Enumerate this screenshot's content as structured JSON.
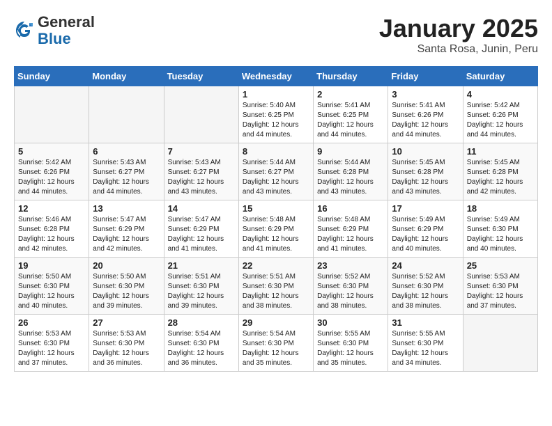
{
  "header": {
    "logo_line1": "General",
    "logo_line2": "Blue",
    "title": "January 2025",
    "subtitle": "Santa Rosa, Junin, Peru"
  },
  "weekdays": [
    "Sunday",
    "Monday",
    "Tuesday",
    "Wednesday",
    "Thursday",
    "Friday",
    "Saturday"
  ],
  "weeks": [
    [
      {
        "day": "",
        "info": ""
      },
      {
        "day": "",
        "info": ""
      },
      {
        "day": "",
        "info": ""
      },
      {
        "day": "1",
        "info": "Sunrise: 5:40 AM\nSunset: 6:25 PM\nDaylight: 12 hours\nand 44 minutes."
      },
      {
        "day": "2",
        "info": "Sunrise: 5:41 AM\nSunset: 6:25 PM\nDaylight: 12 hours\nand 44 minutes."
      },
      {
        "day": "3",
        "info": "Sunrise: 5:41 AM\nSunset: 6:26 PM\nDaylight: 12 hours\nand 44 minutes."
      },
      {
        "day": "4",
        "info": "Sunrise: 5:42 AM\nSunset: 6:26 PM\nDaylight: 12 hours\nand 44 minutes."
      }
    ],
    [
      {
        "day": "5",
        "info": "Sunrise: 5:42 AM\nSunset: 6:26 PM\nDaylight: 12 hours\nand 44 minutes."
      },
      {
        "day": "6",
        "info": "Sunrise: 5:43 AM\nSunset: 6:27 PM\nDaylight: 12 hours\nand 44 minutes."
      },
      {
        "day": "7",
        "info": "Sunrise: 5:43 AM\nSunset: 6:27 PM\nDaylight: 12 hours\nand 43 minutes."
      },
      {
        "day": "8",
        "info": "Sunrise: 5:44 AM\nSunset: 6:27 PM\nDaylight: 12 hours\nand 43 minutes."
      },
      {
        "day": "9",
        "info": "Sunrise: 5:44 AM\nSunset: 6:28 PM\nDaylight: 12 hours\nand 43 minutes."
      },
      {
        "day": "10",
        "info": "Sunrise: 5:45 AM\nSunset: 6:28 PM\nDaylight: 12 hours\nand 43 minutes."
      },
      {
        "day": "11",
        "info": "Sunrise: 5:45 AM\nSunset: 6:28 PM\nDaylight: 12 hours\nand 42 minutes."
      }
    ],
    [
      {
        "day": "12",
        "info": "Sunrise: 5:46 AM\nSunset: 6:28 PM\nDaylight: 12 hours\nand 42 minutes."
      },
      {
        "day": "13",
        "info": "Sunrise: 5:47 AM\nSunset: 6:29 PM\nDaylight: 12 hours\nand 42 minutes."
      },
      {
        "day": "14",
        "info": "Sunrise: 5:47 AM\nSunset: 6:29 PM\nDaylight: 12 hours\nand 41 minutes."
      },
      {
        "day": "15",
        "info": "Sunrise: 5:48 AM\nSunset: 6:29 PM\nDaylight: 12 hours\nand 41 minutes."
      },
      {
        "day": "16",
        "info": "Sunrise: 5:48 AM\nSunset: 6:29 PM\nDaylight: 12 hours\nand 41 minutes."
      },
      {
        "day": "17",
        "info": "Sunrise: 5:49 AM\nSunset: 6:29 PM\nDaylight: 12 hours\nand 40 minutes."
      },
      {
        "day": "18",
        "info": "Sunrise: 5:49 AM\nSunset: 6:30 PM\nDaylight: 12 hours\nand 40 minutes."
      }
    ],
    [
      {
        "day": "19",
        "info": "Sunrise: 5:50 AM\nSunset: 6:30 PM\nDaylight: 12 hours\nand 40 minutes."
      },
      {
        "day": "20",
        "info": "Sunrise: 5:50 AM\nSunset: 6:30 PM\nDaylight: 12 hours\nand 39 minutes."
      },
      {
        "day": "21",
        "info": "Sunrise: 5:51 AM\nSunset: 6:30 PM\nDaylight: 12 hours\nand 39 minutes."
      },
      {
        "day": "22",
        "info": "Sunrise: 5:51 AM\nSunset: 6:30 PM\nDaylight: 12 hours\nand 38 minutes."
      },
      {
        "day": "23",
        "info": "Sunrise: 5:52 AM\nSunset: 6:30 PM\nDaylight: 12 hours\nand 38 minutes."
      },
      {
        "day": "24",
        "info": "Sunrise: 5:52 AM\nSunset: 6:30 PM\nDaylight: 12 hours\nand 38 minutes."
      },
      {
        "day": "25",
        "info": "Sunrise: 5:53 AM\nSunset: 6:30 PM\nDaylight: 12 hours\nand 37 minutes."
      }
    ],
    [
      {
        "day": "26",
        "info": "Sunrise: 5:53 AM\nSunset: 6:30 PM\nDaylight: 12 hours\nand 37 minutes."
      },
      {
        "day": "27",
        "info": "Sunrise: 5:53 AM\nSunset: 6:30 PM\nDaylight: 12 hours\nand 36 minutes."
      },
      {
        "day": "28",
        "info": "Sunrise: 5:54 AM\nSunset: 6:30 PM\nDaylight: 12 hours\nand 36 minutes."
      },
      {
        "day": "29",
        "info": "Sunrise: 5:54 AM\nSunset: 6:30 PM\nDaylight: 12 hours\nand 35 minutes."
      },
      {
        "day": "30",
        "info": "Sunrise: 5:55 AM\nSunset: 6:30 PM\nDaylight: 12 hours\nand 35 minutes."
      },
      {
        "day": "31",
        "info": "Sunrise: 5:55 AM\nSunset: 6:30 PM\nDaylight: 12 hours\nand 34 minutes."
      },
      {
        "day": "",
        "info": ""
      }
    ]
  ]
}
